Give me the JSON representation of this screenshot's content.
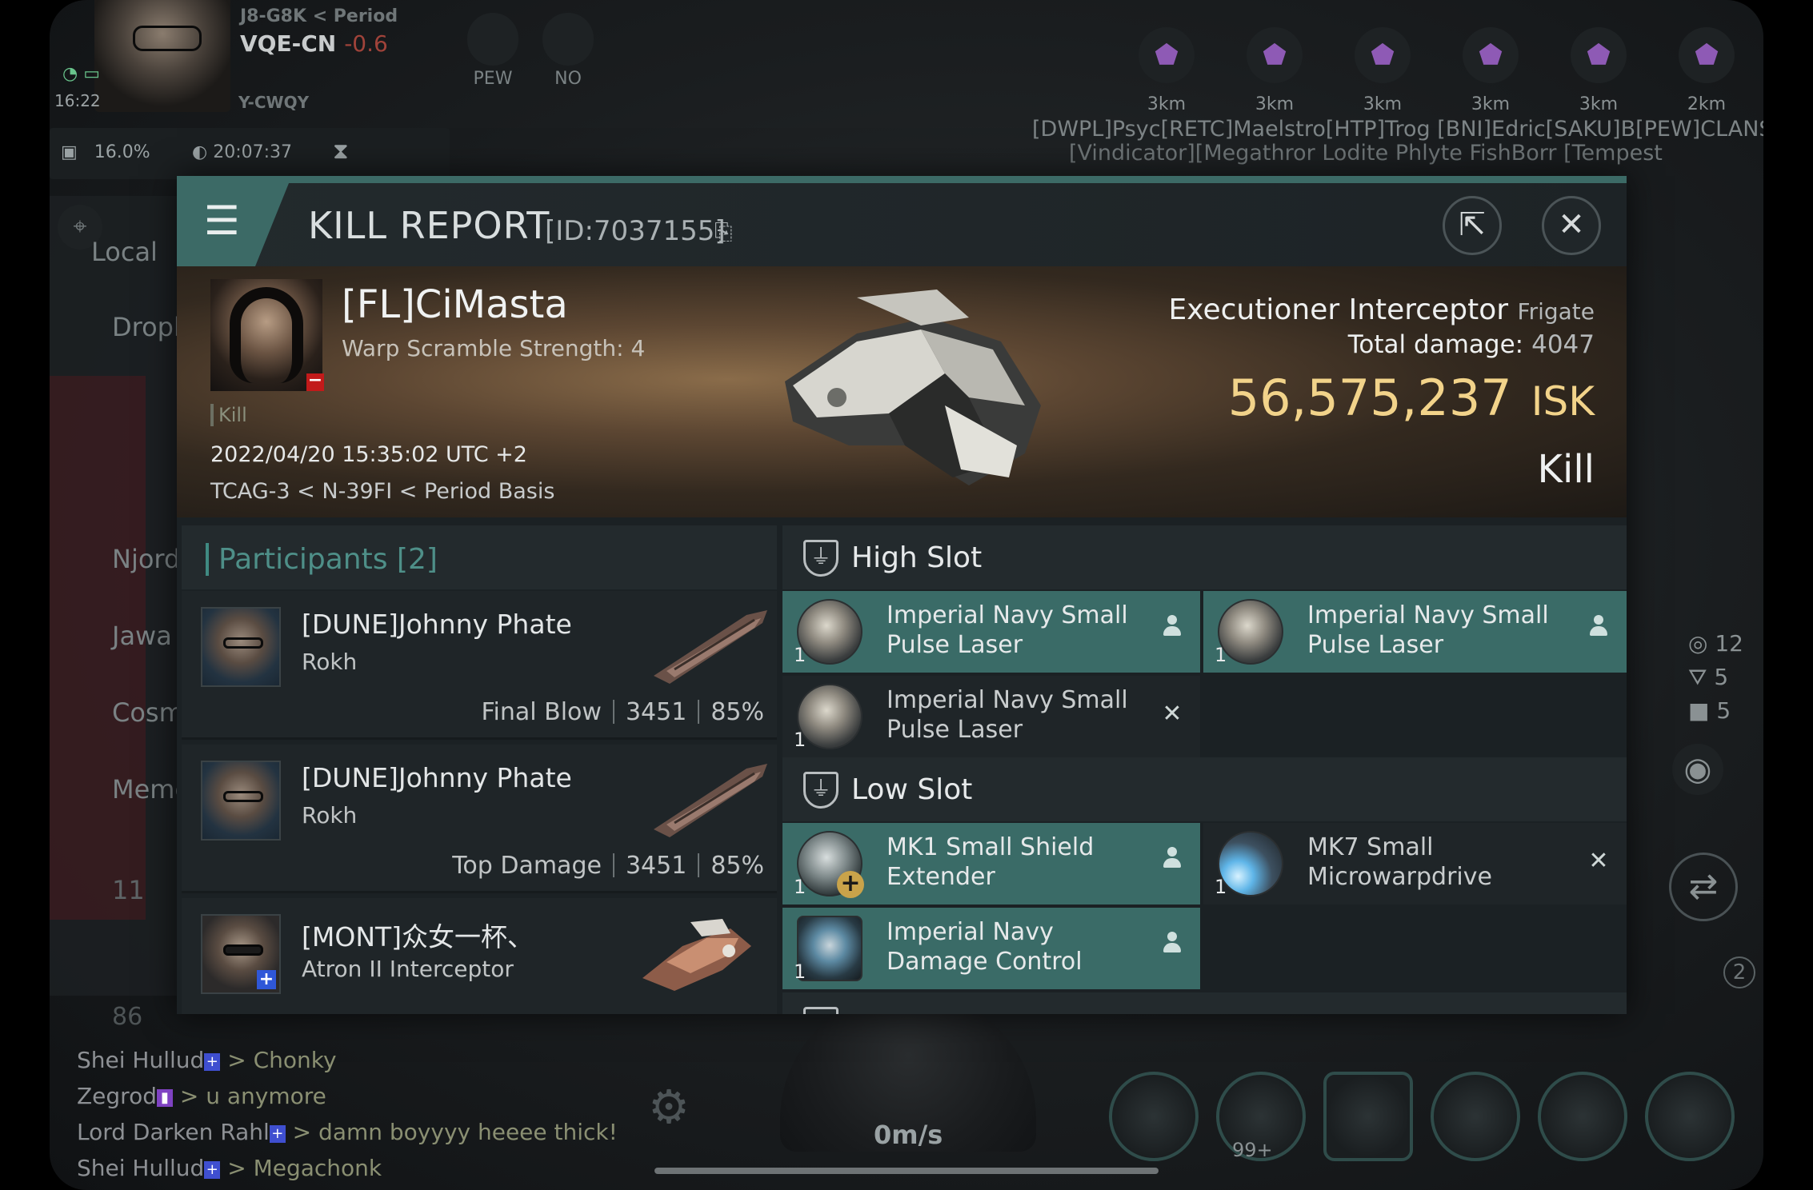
{
  "hud": {
    "region_route": "J8-G8K < Period",
    "system": "VQE-CN",
    "security": "-0.6",
    "clock": "16:22",
    "corp_ticker": "Y-CWQY",
    "stat_cargo": "16.0%",
    "stat_timer": "20:07:37",
    "fleet_buttons": [
      "PEW",
      "NO"
    ],
    "side_tabs": [
      "Local",
      "Dropb",
      "Njord",
      "Jawa",
      "Cosm",
      "Memo"
    ],
    "side_count": "11",
    "side_count2": "86"
  },
  "overview": {
    "ranges": [
      "3km",
      "3km",
      "3km",
      "3km",
      "3km",
      "2km"
    ],
    "names_line": "[DWPL]Psyc[RETC]Maelstro[HTP]Trog [BNI]Edric[SAKU]B[PEW]CLANSMAN",
    "types_line": "[Vindicator][Megathror  Lodite   Phlyte  FishBorr  [Tempest"
  },
  "right_stats": {
    "targets": "12",
    "drones": "5",
    "modules": "5"
  },
  "chat": [
    {
      "who": "Shei Hullud",
      "badge": "blue",
      "msg": " > Chonky"
    },
    {
      "who": "Zegrod",
      "badge": "purple",
      "msg": " > u anymore"
    },
    {
      "who": "Lord Darken Rahl",
      "badge": "blue",
      "msg": " > damn boyyyy heeee thick!"
    },
    {
      "who": "Shei Hullud",
      "badge": "blue",
      "msg": " > Megachonk"
    }
  ],
  "speed": "0m/s",
  "module_badge": "99+",
  "drone_count": "2",
  "kill_report": {
    "title": "KILL REPORT",
    "id": "[ID:7037155]",
    "victim": {
      "name": "[FL]CiMasta",
      "warp_scramble": "Warp Scramble Strength: 4",
      "tag": "Kill",
      "datetime": "2022/04/20 15:35:02 UTC +2",
      "location": "TCAG-3 < N-39FI < Period Basis",
      "ship": "Executioner Interceptor",
      "ship_class": "Frigate",
      "total_damage_label": "Total damage:",
      "total_damage": "4047",
      "isk_value": "56,575,237",
      "isk_unit": "ISK",
      "result": "Kill"
    },
    "participants_title": "Participants [2]",
    "participants": [
      {
        "name": "[DUNE]Johnny Phate",
        "ship": "Rokh",
        "role": "Final Blow",
        "damage": "3451",
        "pct": "85%"
      },
      {
        "name": "[DUNE]Johnny Phate",
        "ship": "Rokh",
        "role": "Top Damage",
        "damage": "3451",
        "pct": "85%"
      },
      {
        "name": "[MONT]众女一杯、",
        "ship": "Atron II Interceptor"
      }
    ],
    "high_slot_title": "High Slot",
    "low_slot_title": "Low Slot",
    "high_slots": [
      {
        "qty": "1",
        "name": "Imperial Navy Small Pulse Laser",
        "state": "dropped"
      },
      {
        "qty": "1",
        "name": "Imperial Navy Small Pulse Laser",
        "state": "dropped"
      },
      {
        "qty": "1",
        "name": "Imperial Navy Small Pulse Laser",
        "state": "destroyed"
      }
    ],
    "low_slots": [
      {
        "qty": "1",
        "name": "MK1 Small Shield Extender",
        "state": "dropped"
      },
      {
        "qty": "1",
        "name": "MK7 Small Microwarpdrive",
        "state": "destroyed"
      },
      {
        "qty": "1",
        "name": "Imperial Navy Damage Control",
        "state": "dropped"
      }
    ]
  }
}
